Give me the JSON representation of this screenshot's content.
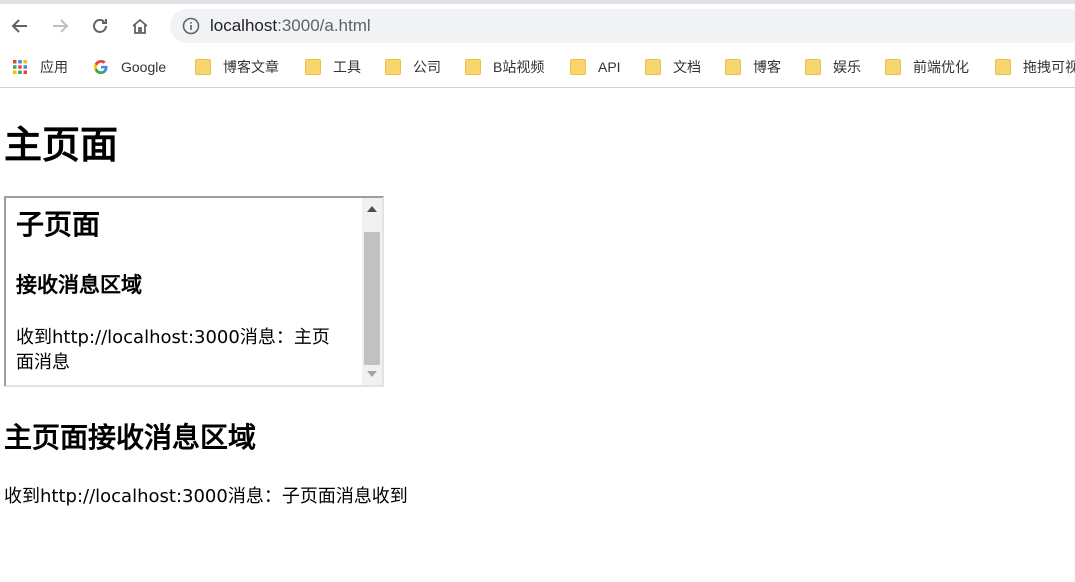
{
  "browser": {
    "url_host": "localhost",
    "url_rest": ":3000/a.html",
    "bookmarks": [
      {
        "label": "应用",
        "icon": "apps-grid-icon"
      },
      {
        "label": "Google",
        "icon": "google-g-icon"
      },
      {
        "label": "博客文章",
        "icon": "folder-icon"
      },
      {
        "label": "工具",
        "icon": "folder-icon"
      },
      {
        "label": "公司",
        "icon": "folder-icon"
      },
      {
        "label": "B站视频",
        "icon": "folder-icon"
      },
      {
        "label": "API",
        "icon": "folder-icon"
      },
      {
        "label": "文档",
        "icon": "folder-icon"
      },
      {
        "label": "博客",
        "icon": "folder-icon"
      },
      {
        "label": "娱乐",
        "icon": "folder-icon"
      },
      {
        "label": "前端优化",
        "icon": "folder-icon"
      },
      {
        "label": "拖拽可视",
        "icon": "folder-icon"
      }
    ]
  },
  "page": {
    "title": "主页面",
    "iframe": {
      "title": "子页面",
      "subtitle": "接收消息区域",
      "message": "收到http://localhost:3000消息：主页面消息"
    },
    "receive_title": "主页面接收消息区域",
    "receive_message": "收到http://localhost:3000消息：子页面消息收到"
  }
}
